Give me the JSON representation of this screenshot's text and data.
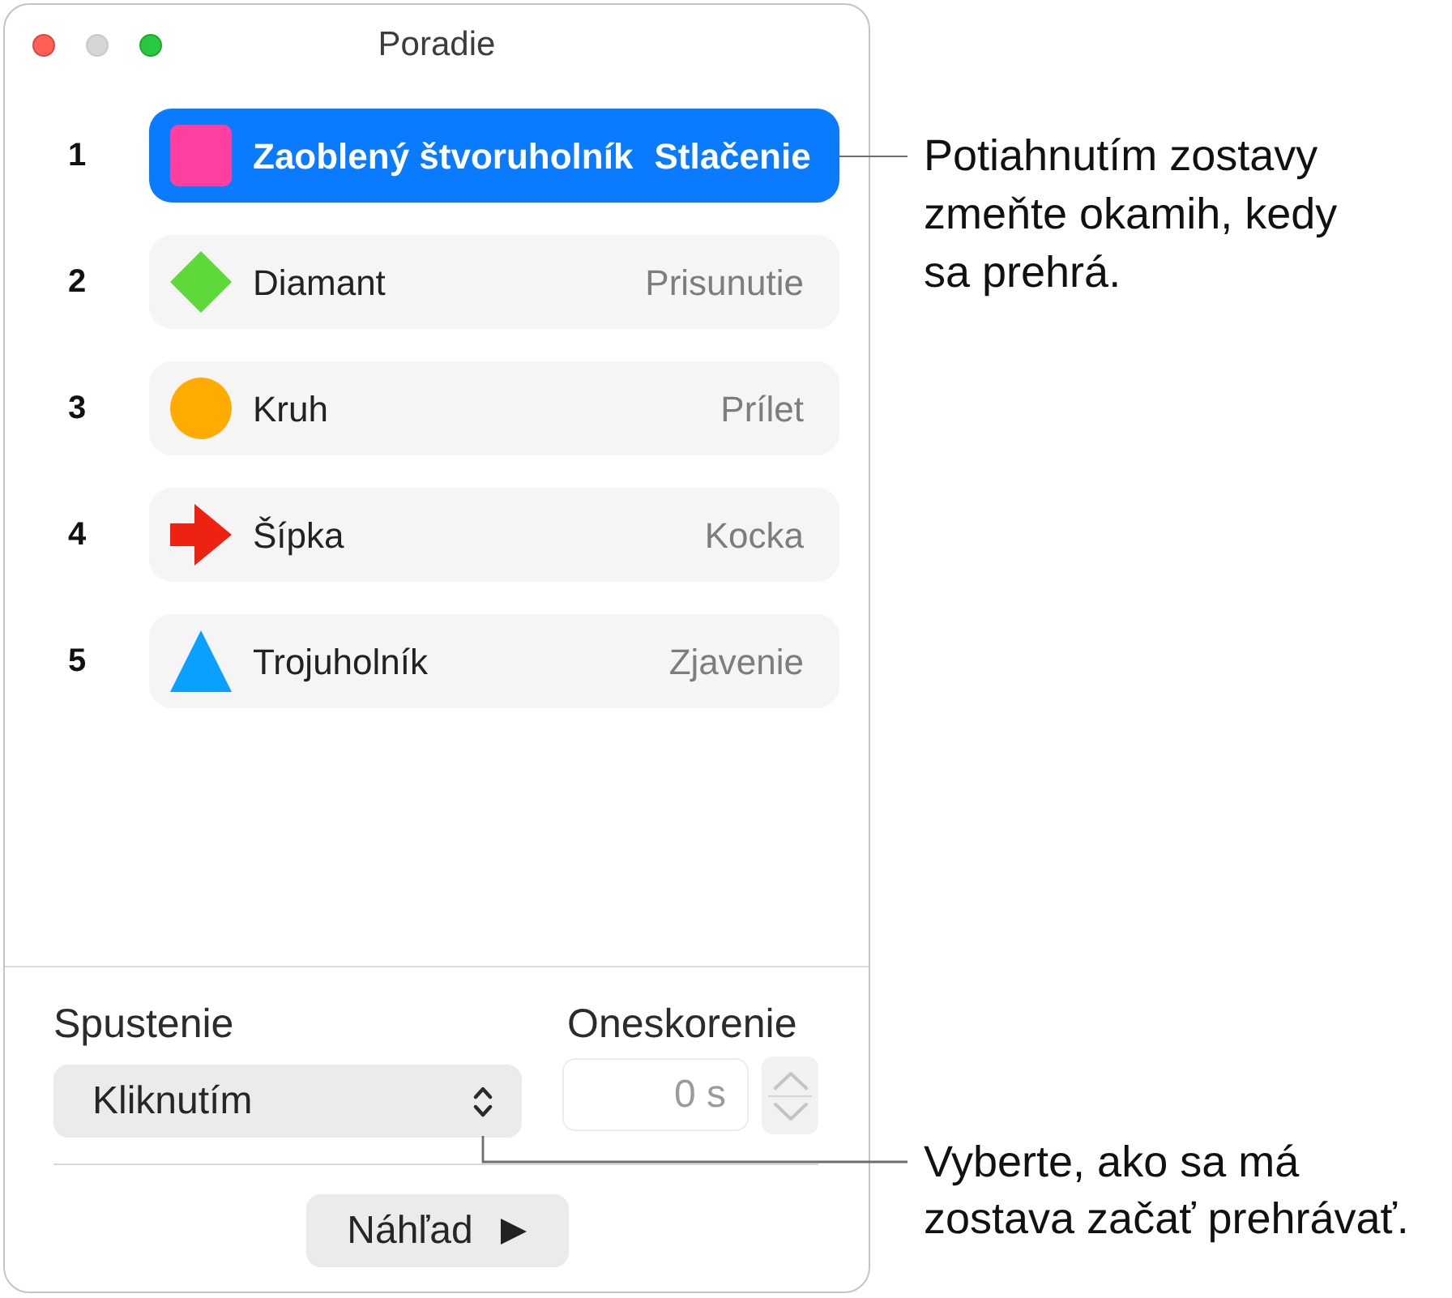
{
  "window": {
    "title": "Poradie",
    "controls": [
      {
        "kind": "close",
        "disabled": false
      },
      {
        "kind": "minimize",
        "disabled": true
      },
      {
        "kind": "zoom",
        "disabled": false
      }
    ]
  },
  "builds": [
    {
      "number": "1",
      "kind": "square",
      "color": "#ff3fa0",
      "name": "Zaoblený štvoruholník",
      "effect": "Stlačenie",
      "selected": true
    },
    {
      "number": "2",
      "kind": "diamond",
      "color": "#5fd83a",
      "name": "Diamant",
      "effect": "Prisunutie",
      "selected": false
    },
    {
      "number": "3",
      "kind": "circle",
      "color": "#ffab00",
      "name": "Kruh",
      "effect": "Prílet",
      "selected": false
    },
    {
      "number": "4",
      "kind": "arrow",
      "color": "#ee2211",
      "name": "Šípka",
      "effect": "Kocka",
      "selected": false
    },
    {
      "number": "5",
      "kind": "triangle",
      "color": "#0aa0ff",
      "name": "Trojuholník",
      "effect": "Zjavenie",
      "selected": false
    }
  ],
  "start": {
    "label": "Spustenie",
    "value": "Kliknutím"
  },
  "delay": {
    "label": "Oneskorenie",
    "value": "0 s",
    "disabled": true
  },
  "preview_button": {
    "label": "Náhľad"
  },
  "callouts": [
    {
      "text": "Potiahnutím zostavy zmeňte okamih, kedy sa prehrá."
    },
    {
      "text": "Vyberte, ako sa má zostava začať prehrávať."
    }
  ]
}
